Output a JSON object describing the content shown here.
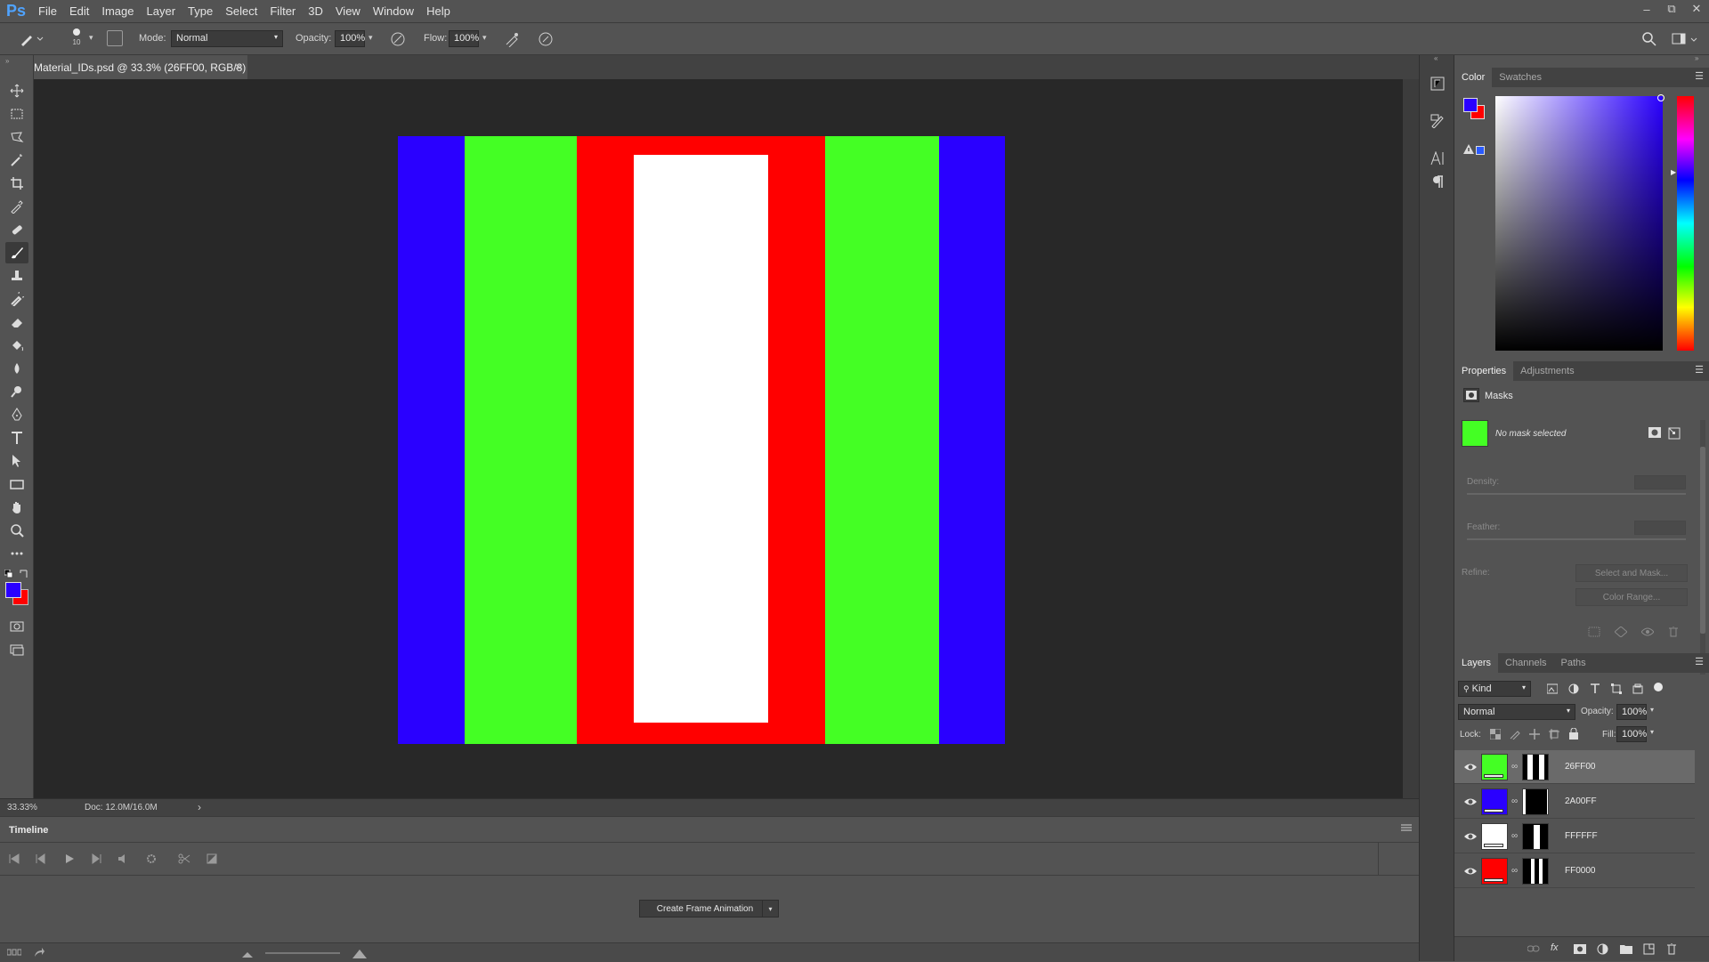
{
  "app": {
    "logo": "Ps"
  },
  "menu": [
    "File",
    "Edit",
    "Image",
    "Layer",
    "Type",
    "Select",
    "Filter",
    "3D",
    "View",
    "Window",
    "Help"
  ],
  "window_controls": {
    "minimize": "–",
    "restore": "⧉",
    "close": "✕"
  },
  "options_bar": {
    "brush_size": "10",
    "mode_label": "Mode:",
    "mode_value": "Normal",
    "opacity_label": "Opacity:",
    "opacity_value": "100%",
    "flow_label": "Flow:",
    "flow_value": "100%"
  },
  "document": {
    "tab_title": "Material_IDs.psd @ 33.3% (26FF00, RGB/8)",
    "close": "×",
    "zoom": "33.33%",
    "doc_info": "Doc: 12.0M/16.0M",
    "artboard_colors": {
      "blue": "#2a00ff",
      "green": "#44ff24",
      "red": "#ff0000",
      "white": "#ffffff"
    }
  },
  "timeline": {
    "title": "Timeline",
    "create_button": "Create Frame Animation"
  },
  "color_panel": {
    "tabs": [
      "Color",
      "Swatches"
    ],
    "foreground": "#2a00ff",
    "background": "#ff0000"
  },
  "properties_panel": {
    "tabs": [
      "Properties",
      "Adjustments"
    ],
    "section": "Masks",
    "status": "No mask selected",
    "density_label": "Density:",
    "feather_label": "Feather:",
    "refine_label": "Refine:",
    "select_and_mask": "Select and Mask...",
    "color_range": "Color Range..."
  },
  "layers_panel": {
    "tabs": [
      "Layers",
      "Channels",
      "Paths"
    ],
    "filter_kind": "Kind",
    "blend_mode": "Normal",
    "opacity_label": "Opacity:",
    "opacity_value": "100%",
    "lock_label": "Lock:",
    "fill_label": "Fill:",
    "fill_value": "100%",
    "layers": [
      {
        "name": "26FF00",
        "color": "#44ff24",
        "selected": true
      },
      {
        "name": "2A00FF",
        "color": "#2a00ff",
        "selected": false
      },
      {
        "name": "FFFFFF",
        "color": "#ffffff",
        "selected": false
      },
      {
        "name": "FF0000",
        "color": "#ff0000",
        "selected": false
      }
    ]
  }
}
